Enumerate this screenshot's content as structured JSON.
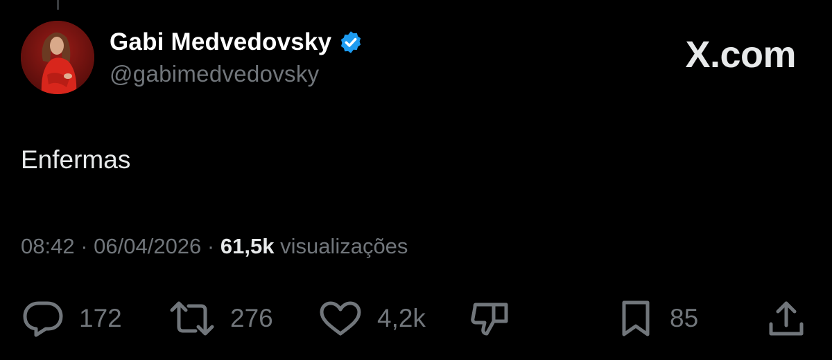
{
  "author": {
    "display_name": "Gabi Medvedovsky",
    "handle": "@gabimedvedovsky",
    "verified": true,
    "verified_color": "#1d9bf0"
  },
  "brand": "X.com",
  "tweet": {
    "text": "Enfermas",
    "time": "08:42",
    "date": "06/04/2026",
    "views_count": "61,5k",
    "views_label": "visualizações"
  },
  "actions": {
    "replies": "172",
    "reposts": "276",
    "likes": "4,2k",
    "bookmarks": "85"
  },
  "colors": {
    "background": "#000000",
    "primary_text": "#e7e9ea",
    "secondary_text": "#71767b"
  }
}
